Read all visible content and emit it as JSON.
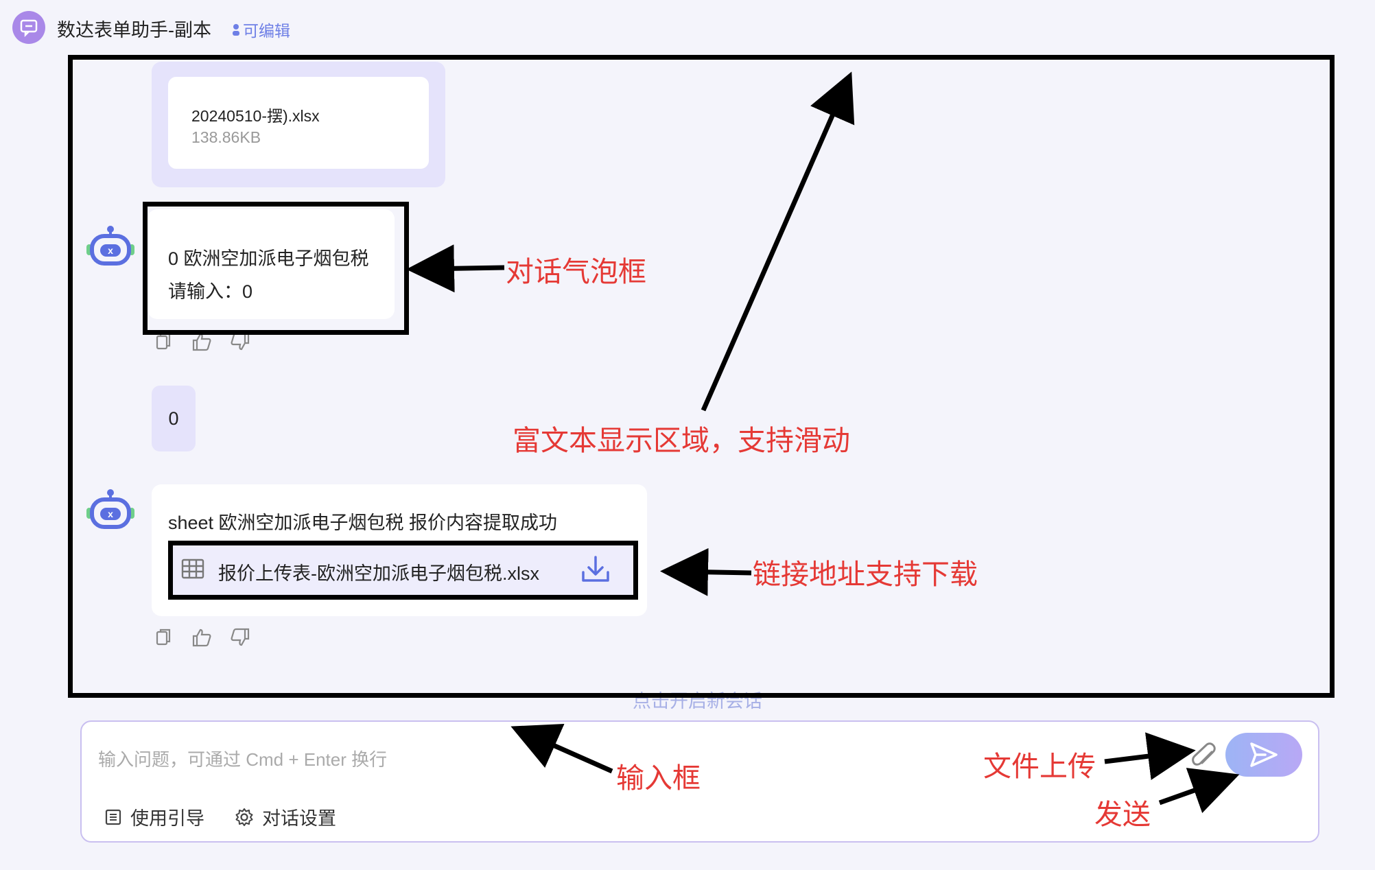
{
  "header": {
    "title": "数达表单助手-副本",
    "edit_badge": "可编辑"
  },
  "chat": {
    "file_card": {
      "name": "20240510-摆).xlsx",
      "size": "138.86KB"
    },
    "bot_message_1": {
      "line1": "0 欧洲空加派电子烟包税",
      "line2": "请输入：0"
    },
    "user_message": "0",
    "bot_message_2": {
      "text": "sheet 欧洲空加派电子烟包税 报价内容提取成功",
      "link": "报价上传表-欧洲空加派电子烟包税.xlsx"
    },
    "new_session": "点击开启新会话"
  },
  "input": {
    "placeholder": "输入问题，可通过 Cmd + Enter 换行",
    "guide_label": "使用引导",
    "settings_label": "对话设置"
  },
  "annotations": {
    "bubble": "对话气泡框",
    "rich_text": "富文本显示区域，支持滑动",
    "download": "链接地址支持下载",
    "input": "输入框",
    "upload": "文件上传",
    "send": "发送"
  },
  "colors": {
    "accent": "#6e7fe6",
    "annotation": "#e53935",
    "bubble_user": "#e5e3fb"
  }
}
